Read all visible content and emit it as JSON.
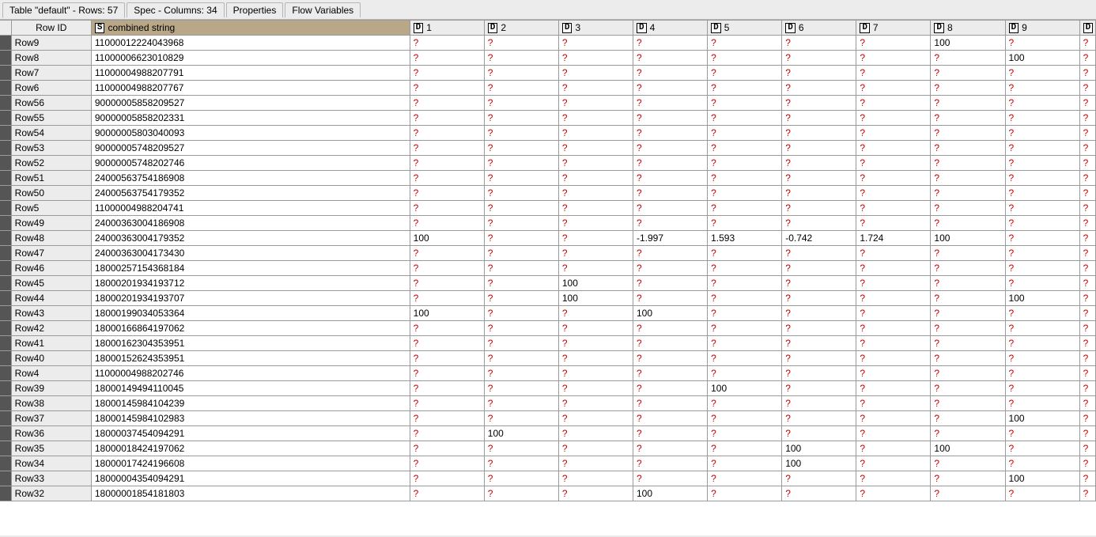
{
  "tabs": [
    {
      "label": "Table \"default\" - Rows: 57"
    },
    {
      "label": "Spec - Columns: 34"
    },
    {
      "label": "Properties"
    },
    {
      "label": "Flow Variables"
    }
  ],
  "active_tab": 0,
  "missing_marker": "?",
  "type_badges": {
    "string": "S",
    "double": "D"
  },
  "columns": {
    "rowid": "Row ID",
    "combined": "combined string",
    "dcols": [
      "1",
      "2",
      "3",
      "4",
      "5",
      "6",
      "7",
      "8",
      "9"
    ]
  },
  "rows": [
    {
      "id": "Row9",
      "combined": "11000012224043968",
      "d": [
        null,
        null,
        null,
        null,
        null,
        null,
        null,
        "100",
        null
      ]
    },
    {
      "id": "Row8",
      "combined": "11000006623010829",
      "d": [
        null,
        null,
        null,
        null,
        null,
        null,
        null,
        null,
        "100"
      ]
    },
    {
      "id": "Row7",
      "combined": "11000004988207791",
      "d": [
        null,
        null,
        null,
        null,
        null,
        null,
        null,
        null,
        null
      ]
    },
    {
      "id": "Row6",
      "combined": "11000004988207767",
      "d": [
        null,
        null,
        null,
        null,
        null,
        null,
        null,
        null,
        null
      ]
    },
    {
      "id": "Row56",
      "combined": "90000005858209527",
      "d": [
        null,
        null,
        null,
        null,
        null,
        null,
        null,
        null,
        null
      ]
    },
    {
      "id": "Row55",
      "combined": "90000005858202331",
      "d": [
        null,
        null,
        null,
        null,
        null,
        null,
        null,
        null,
        null
      ]
    },
    {
      "id": "Row54",
      "combined": "90000005803040093",
      "d": [
        null,
        null,
        null,
        null,
        null,
        null,
        null,
        null,
        null
      ]
    },
    {
      "id": "Row53",
      "combined": "90000005748209527",
      "d": [
        null,
        null,
        null,
        null,
        null,
        null,
        null,
        null,
        null
      ]
    },
    {
      "id": "Row52",
      "combined": "90000005748202746",
      "d": [
        null,
        null,
        null,
        null,
        null,
        null,
        null,
        null,
        null
      ]
    },
    {
      "id": "Row51",
      "combined": "24000563754186908",
      "d": [
        null,
        null,
        null,
        null,
        null,
        null,
        null,
        null,
        null
      ]
    },
    {
      "id": "Row50",
      "combined": "24000563754179352",
      "d": [
        null,
        null,
        null,
        null,
        null,
        null,
        null,
        null,
        null
      ]
    },
    {
      "id": "Row5",
      "combined": "11000004988204741",
      "d": [
        null,
        null,
        null,
        null,
        null,
        null,
        null,
        null,
        null
      ]
    },
    {
      "id": "Row49",
      "combined": "24000363004186908",
      "d": [
        null,
        null,
        null,
        null,
        null,
        null,
        null,
        null,
        null
      ]
    },
    {
      "id": "Row48",
      "combined": "24000363004179352",
      "d": [
        "100",
        null,
        null,
        "-1.997",
        "1.593",
        "-0.742",
        "1.724",
        "100",
        null
      ]
    },
    {
      "id": "Row47",
      "combined": "24000363004173430",
      "d": [
        null,
        null,
        null,
        null,
        null,
        null,
        null,
        null,
        null
      ]
    },
    {
      "id": "Row46",
      "combined": "18000257154368184",
      "d": [
        null,
        null,
        null,
        null,
        null,
        null,
        null,
        null,
        null
      ]
    },
    {
      "id": "Row45",
      "combined": "18000201934193712",
      "d": [
        null,
        null,
        "100",
        null,
        null,
        null,
        null,
        null,
        null
      ]
    },
    {
      "id": "Row44",
      "combined": "18000201934193707",
      "d": [
        null,
        null,
        "100",
        null,
        null,
        null,
        null,
        null,
        "100"
      ]
    },
    {
      "id": "Row43",
      "combined": "18000199034053364",
      "d": [
        "100",
        null,
        null,
        "100",
        null,
        null,
        null,
        null,
        null
      ]
    },
    {
      "id": "Row42",
      "combined": "18000166864197062",
      "d": [
        null,
        null,
        null,
        null,
        null,
        null,
        null,
        null,
        null
      ]
    },
    {
      "id": "Row41",
      "combined": "18000162304353951",
      "d": [
        null,
        null,
        null,
        null,
        null,
        null,
        null,
        null,
        null
      ]
    },
    {
      "id": "Row40",
      "combined": "18000152624353951",
      "d": [
        null,
        null,
        null,
        null,
        null,
        null,
        null,
        null,
        null
      ]
    },
    {
      "id": "Row4",
      "combined": "11000004988202746",
      "d": [
        null,
        null,
        null,
        null,
        null,
        null,
        null,
        null,
        null
      ]
    },
    {
      "id": "Row39",
      "combined": "18000149494110045",
      "d": [
        null,
        null,
        null,
        null,
        "100",
        null,
        null,
        null,
        null
      ]
    },
    {
      "id": "Row38",
      "combined": "18000145984104239",
      "d": [
        null,
        null,
        null,
        null,
        null,
        null,
        null,
        null,
        null
      ]
    },
    {
      "id": "Row37",
      "combined": "18000145984102983",
      "d": [
        null,
        null,
        null,
        null,
        null,
        null,
        null,
        null,
        "100"
      ]
    },
    {
      "id": "Row36",
      "combined": "18000037454094291",
      "d": [
        null,
        "100",
        null,
        null,
        null,
        null,
        null,
        null,
        null
      ]
    },
    {
      "id": "Row35",
      "combined": "18000018424197062",
      "d": [
        null,
        null,
        null,
        null,
        null,
        "100",
        null,
        "100",
        null
      ]
    },
    {
      "id": "Row34",
      "combined": "18000017424196608",
      "d": [
        null,
        null,
        null,
        null,
        null,
        "100",
        null,
        null,
        null
      ]
    },
    {
      "id": "Row33",
      "combined": "18000004354094291",
      "d": [
        null,
        null,
        null,
        null,
        null,
        null,
        null,
        null,
        "100"
      ]
    },
    {
      "id": "Row32",
      "combined": "18000001854181803",
      "d": [
        null,
        null,
        null,
        "100",
        null,
        null,
        null,
        null,
        null
      ]
    }
  ]
}
